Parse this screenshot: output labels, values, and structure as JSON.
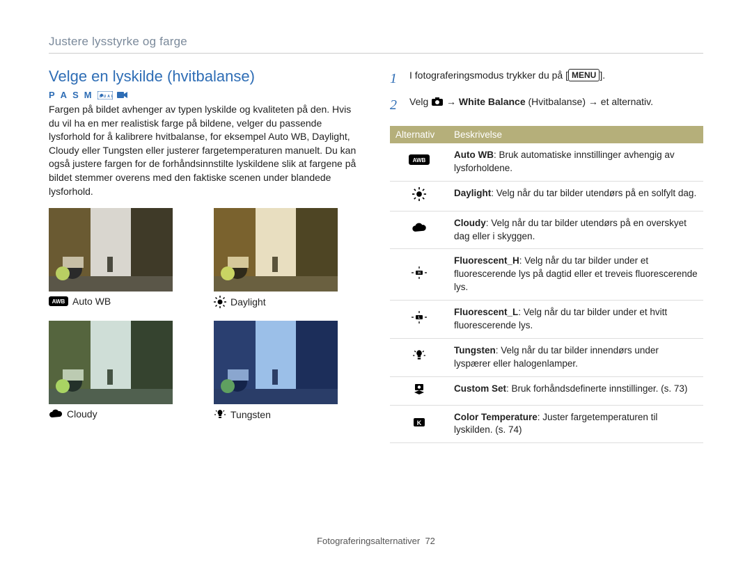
{
  "breadcrumb": "Justere lysstyrke og farge",
  "section_title": "Velge en lyskilde (hvitbalanse)",
  "modes": [
    "P",
    "A",
    "S",
    "M"
  ],
  "mode_extra": "DUAL",
  "body_text": "Fargen på bildet avhenger av typen lyskilde og kvaliteten på den. Hvis du vil ha en mer realistisk farge på bildene, velger du passende lysforhold for å kalibrere hvitbalanse, for eksempel Auto WB, Daylight, Cloudy eller Tungsten eller justerer fargetemperaturen manuelt. Du kan også justere fargen for de forhåndsinnstilte lyskildene slik at fargene på bildet stemmer overens med den faktiske scenen under blandede lysforhold.",
  "thumbs": [
    {
      "icon": "awb",
      "label": "Auto WB",
      "tint": "none"
    },
    {
      "icon": "sun",
      "label": "Daylight",
      "tint": "warm"
    },
    {
      "icon": "cloud",
      "label": "Cloudy",
      "tint": "cool"
    },
    {
      "icon": "bulb",
      "label": "Tungsten",
      "tint": "blue"
    }
  ],
  "steps": {
    "1": {
      "pre": "I fotograferingsmodus trykker du på [",
      "menu": "MENU",
      "post": "]."
    },
    "2": {
      "pre": "Velg ",
      "arrow": "→",
      "mid_bold": "White Balance",
      "mid_after": " (Hvitbalanse) ",
      "tail": " et alternativ."
    }
  },
  "table": {
    "headers": [
      "Alternativ",
      "Beskrivelse"
    ],
    "rows": [
      {
        "icon": "awb",
        "title": "Auto WB",
        "desc": ": Bruk automatiske innstillinger avhengig av lysforholdene."
      },
      {
        "icon": "sun",
        "title": "Daylight",
        "desc": ": Velg når du tar bilder utendørs på en solfylt dag."
      },
      {
        "icon": "cloud",
        "title": "Cloudy",
        "desc": ": Velg når du tar bilder utendørs på en overskyet dag eller i skyggen."
      },
      {
        "icon": "fluoh",
        "title": "Fluorescent_H",
        "desc": ": Velg når du tar bilder under et fluorescerende lys på dagtid eller et treveis fluorescerende lys."
      },
      {
        "icon": "fluol",
        "title": "Fluorescent_L",
        "desc": ": Velg når du tar bilder under et hvitt fluorescerende lys."
      },
      {
        "icon": "bulb",
        "title": "Tungsten",
        "desc": ": Velg når du tar bilder innendørs under lyspærer eller halogenlamper."
      },
      {
        "icon": "custom",
        "title": "Custom Set",
        "desc": ": Bruk forhåndsdefinerte innstillinger. (s. 73)"
      },
      {
        "icon": "kelvin",
        "title": "Color Temperature",
        "desc": ": Juster fargetemperaturen til lyskilden. (s. 74)"
      }
    ]
  },
  "footer": {
    "label": "Fotograferingsalternativer",
    "page": "72"
  }
}
